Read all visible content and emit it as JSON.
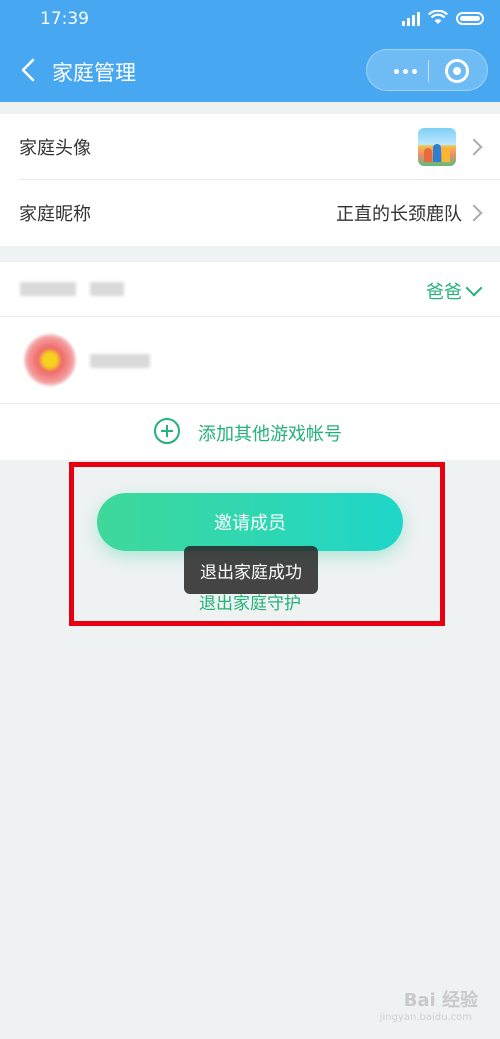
{
  "status_bar": {
    "time": "17:39"
  },
  "nav": {
    "title": "家庭管理"
  },
  "settings": {
    "avatar_label": "家庭头像",
    "nickname_label": "家庭昵称",
    "nickname_value": "正直的长颈鹿队"
  },
  "account": {
    "role": "爸爸",
    "add_account_label": "添加其他游戏帐号"
  },
  "actions": {
    "invite_label": "邀请成员",
    "exit_label": "退出家庭守护"
  },
  "toast": {
    "text": "退出家庭成功"
  },
  "watermark": {
    "brand": "Bai 经验",
    "sub": "jingyan.baidu.com"
  },
  "colors": {
    "nav_blue": "#47a8f1",
    "accent_green": "#24b17a",
    "highlight_red": "#e60012"
  }
}
